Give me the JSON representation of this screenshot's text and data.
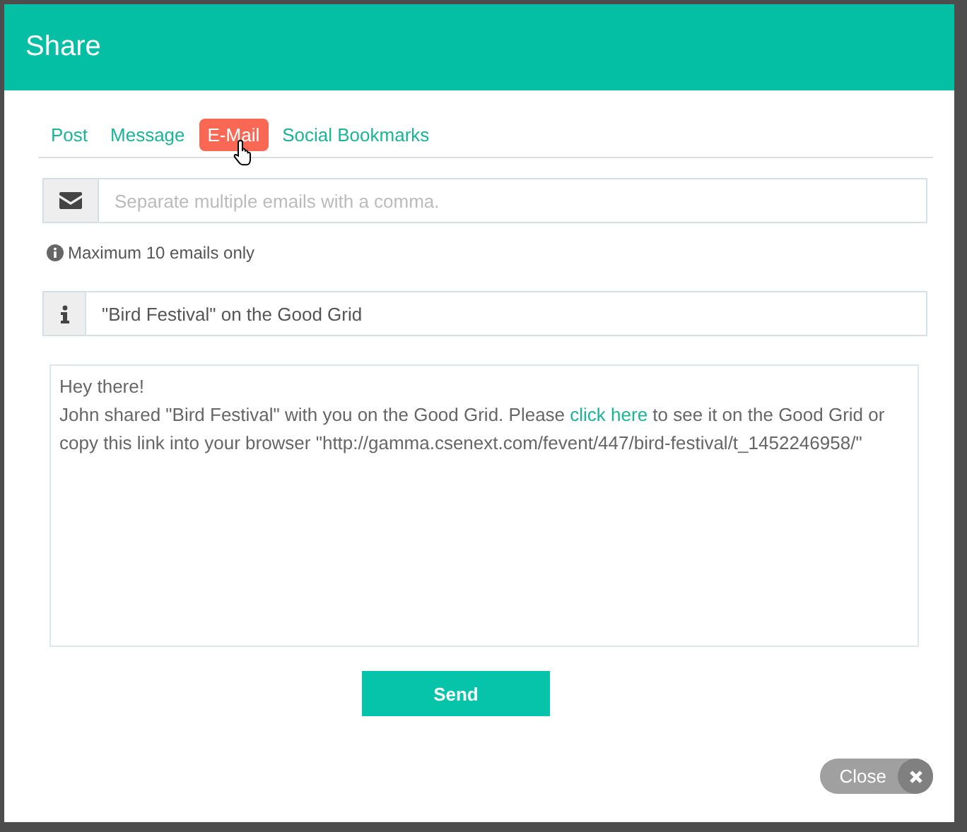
{
  "dialog": {
    "title": "Share"
  },
  "tabs": [
    {
      "label": "Post",
      "selected": false
    },
    {
      "label": "Message",
      "selected": false
    },
    {
      "label": "E-Mail",
      "selected": true
    },
    {
      "label": "Social Bookmarks",
      "selected": false
    }
  ],
  "email_field": {
    "placeholder": "Separate multiple emails with a comma."
  },
  "email_note": "Maximum 10 emails only",
  "subject_field": {
    "value": "\"Bird Festival\" on the Good Grid"
  },
  "message": {
    "greeting": "Hey there!",
    "before_link": "John shared \"Bird Festival\" with you on the Good Grid. Please ",
    "link": "click here",
    "after_link": " to see it on the Good Grid or copy this link into your browser \"http://gamma.csenext.com/fevent/447/bird-festival/t_1452246958/\""
  },
  "send_button": "Send",
  "close_button": "Close"
}
